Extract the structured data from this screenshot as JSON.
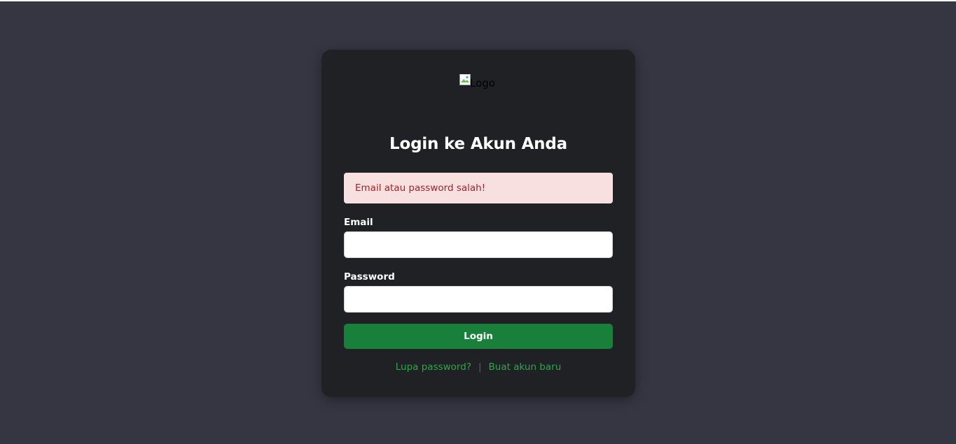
{
  "logo": {
    "alt": "Logo",
    "icon": "broken-image-icon"
  },
  "login": {
    "title": "Login ke Akun Anda",
    "alert": "Email atau password salah!",
    "email_label": "Email",
    "email_value": "",
    "password_label": "Password",
    "password_value": "",
    "button_label": "Login"
  },
  "links": {
    "forgot": "Lupa password?",
    "separator": "|",
    "register": "Buat akun baru"
  },
  "colors": {
    "background": "#363542",
    "card": "#202124",
    "button": "#18803a",
    "link": "#2aa84a",
    "alert_bg": "#f8dfe0",
    "alert_text": "#9b2424"
  }
}
